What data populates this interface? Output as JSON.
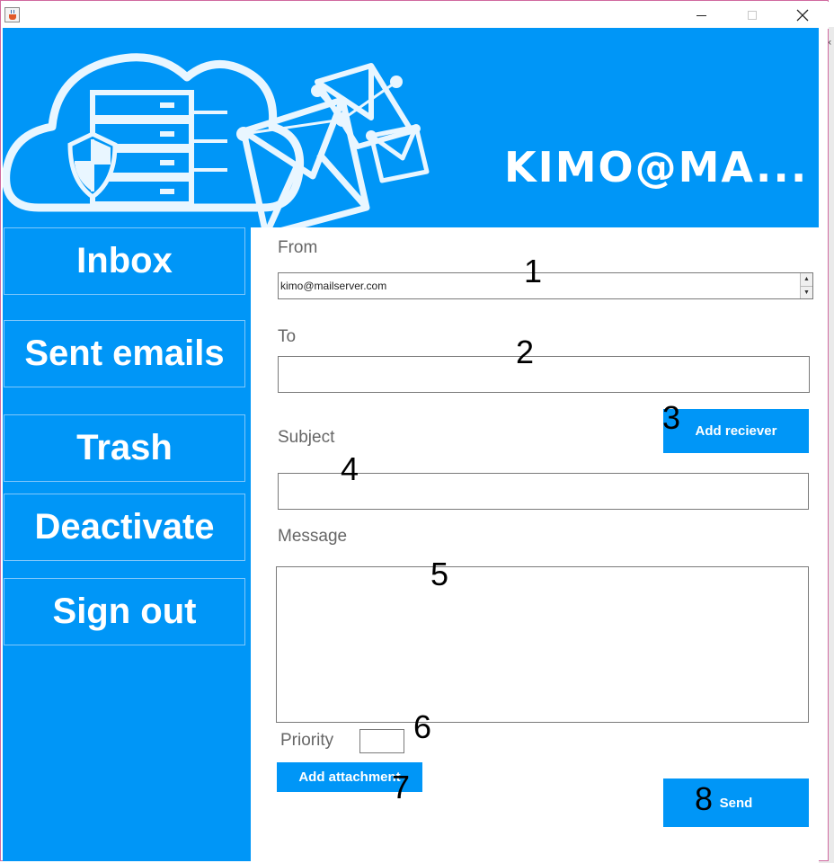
{
  "window": {
    "minimize_glyph": "—",
    "maximize_glyph": "☐",
    "close_glyph": "✕"
  },
  "banner": {
    "brand": "KIMO@MA..."
  },
  "nav": {
    "items": [
      {
        "label": "Inbox"
      },
      {
        "label": "Sent emails"
      },
      {
        "label": "Trash"
      },
      {
        "label": "Deactivate"
      },
      {
        "label": "Sign out"
      }
    ]
  },
  "compose": {
    "from_label": "From",
    "from_value": "kimo@mailserver.com",
    "to_label": "To",
    "to_value": "",
    "subject_label": "Subject",
    "subject_value": "",
    "message_label": "Message",
    "message_value": "",
    "priority_label": "Priority",
    "priority_value": "",
    "add_receiver_label": "Add reciever",
    "add_attachment_label": "Add attachment",
    "send_label": "Send"
  },
  "annotations": [
    "1",
    "2",
    "3",
    "4",
    "5",
    "6",
    "7",
    "8"
  ],
  "colors": {
    "accent": "#0096f7",
    "label_text": "#666666",
    "border": "#7a7a7a"
  }
}
